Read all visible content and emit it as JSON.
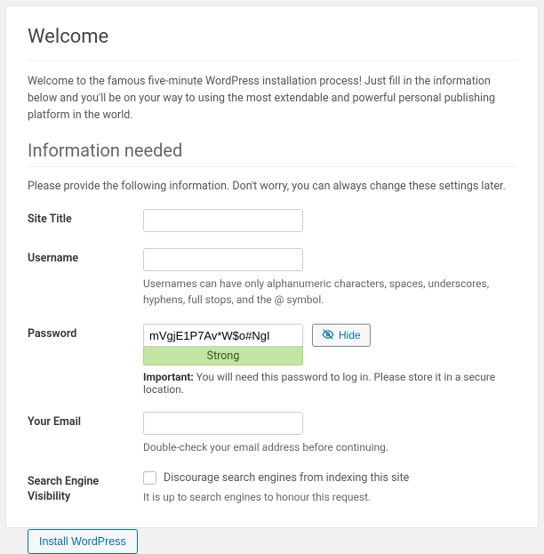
{
  "headings": {
    "welcome": "Welcome",
    "info_needed": "Information needed"
  },
  "intro": "Welcome to the famous five-minute WordPress installation process! Just fill in the information below and you'll be on your way to using the most extendable and powerful personal publishing platform in the world.",
  "instructions": "Please provide the following information. Don't worry, you can always change these settings later.",
  "fields": {
    "site_title": {
      "label": "Site Title",
      "value": ""
    },
    "username": {
      "label": "Username",
      "value": "",
      "hint": "Usernames can have only alphanumeric characters, spaces, underscores, hyphens, full stops, and the @ symbol."
    },
    "password": {
      "label": "Password",
      "value": "mVgjE1P7Av*W$o#NgI",
      "hide_btn": "Hide",
      "strength": "Strong",
      "important_label": "Important:",
      "important_text": " You will need this password to log in. Please store it in a secure location."
    },
    "email": {
      "label": "Your Email",
      "value": "",
      "hint": "Double-check your email address before continuing."
    },
    "search_engine": {
      "label": "Search Engine Visibility",
      "checkbox_label": "Discourage search engines from indexing this site",
      "hint": "It is up to search engines to honour this request."
    }
  },
  "submit": "Install WordPress"
}
